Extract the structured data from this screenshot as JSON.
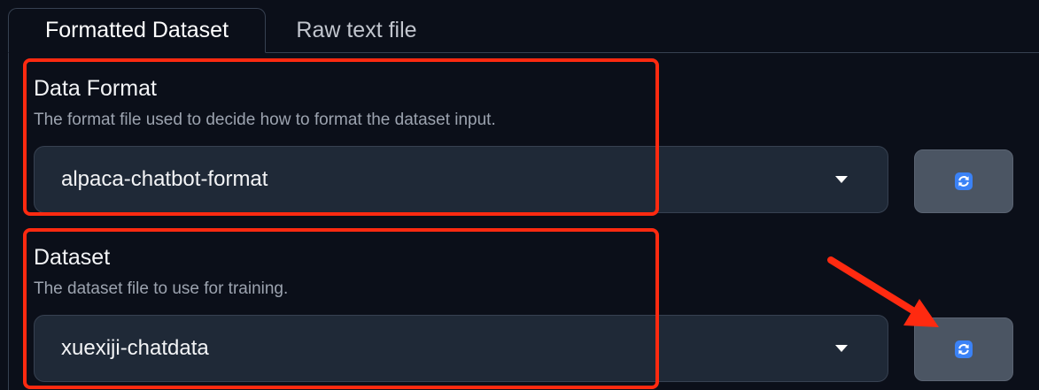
{
  "tabs": [
    {
      "label": "Formatted Dataset",
      "active": true
    },
    {
      "label": "Raw text file",
      "active": false
    }
  ],
  "data_format": {
    "label": "Data Format",
    "info": "The format file used to decide how to format the dataset input.",
    "selected": "alpaca-chatbot-format"
  },
  "dataset": {
    "label": "Dataset",
    "info": "The dataset file to use for training.",
    "selected": "xuexiji-chatdata"
  },
  "icons": {
    "refresh": "refresh-icon",
    "dropdown": "chevron-down-icon"
  },
  "colors": {
    "background": "#0b0f19",
    "input_background": "#1f2937",
    "button_background": "#4b5563",
    "annotation_red": "#ff2a10"
  }
}
